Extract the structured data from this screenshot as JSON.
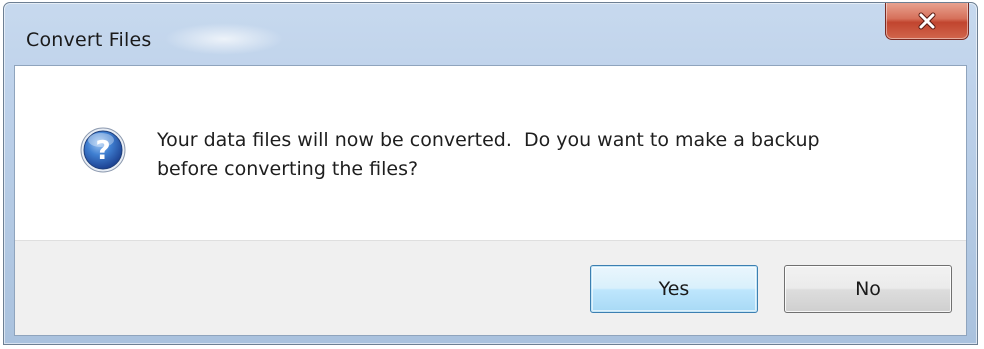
{
  "window": {
    "title": "Convert Files"
  },
  "message": {
    "line1": "Your data files will now be converted.  Do you want to make a backup",
    "line2": "before converting the files?",
    "icon": "question-icon"
  },
  "buttons": {
    "yes_label": "Yes",
    "no_label": "No"
  },
  "titlebar": {
    "close_icon": "close-icon",
    "close_color": "#c7503a"
  }
}
